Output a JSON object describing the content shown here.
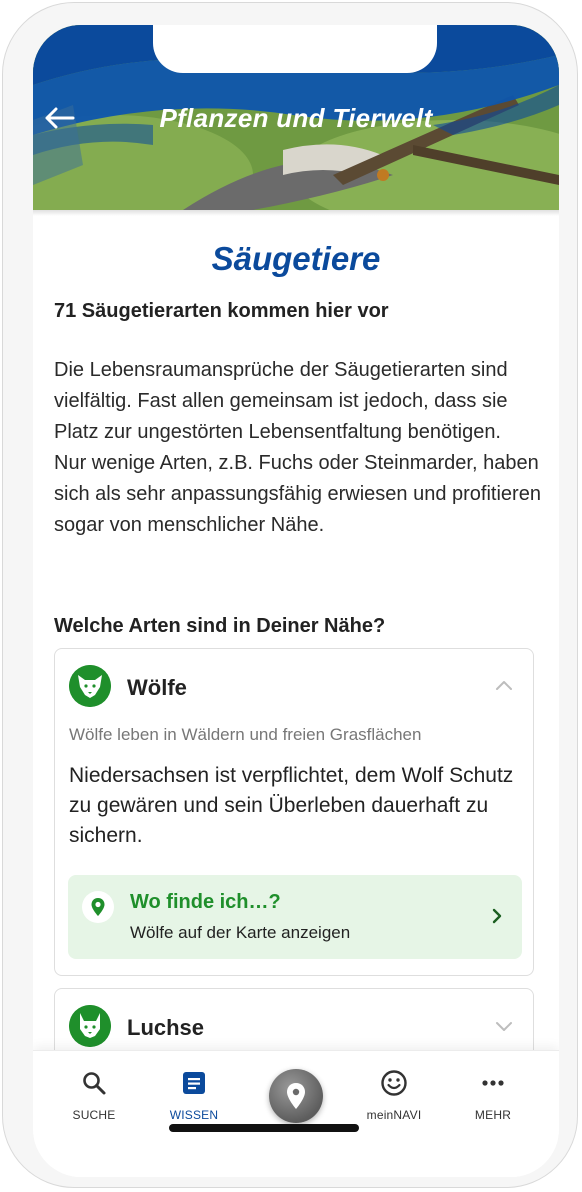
{
  "header": {
    "title": "Pflanzen und Tierwelt",
    "back_icon": "arrow-left-icon"
  },
  "main": {
    "page_title": "Säugetiere",
    "subtitle": "71 Säugetierarten kommen hier vor",
    "body": "Die Lebensraumansprüche der Säugetierarten sind vielfältig. Fast allen gemeinsam ist jedoch, dass sie Platz zur ungestörten Lebensentfaltung benötigen.\nNur wenige Arten, z.B. Fuchs oder Steinmarder, haben sich als sehr anpassungsfähig erwiesen und profitieren sogar von menschlicher Nähe.",
    "question": "Welche Arten sind in Deiner Nähe?",
    "cards": [
      {
        "name": "Wölfe",
        "icon": "wolf-icon",
        "expanded": true,
        "description": "Wölfe leben in Wäldern und freien Grasflächen",
        "body": "Niedersachsen ist verpflichtet, dem Wolf Schutz zu gewären und sein Überleben dauerhaft zu sichern.",
        "find_title": "Wo finde ich…?",
        "find_subtitle": "Wölfe auf der Karte anzeigen"
      },
      {
        "name": "Luchse",
        "icon": "lynx-icon",
        "expanded": false
      }
    ]
  },
  "bottom_nav": {
    "items": [
      {
        "label": "SUCHE",
        "icon": "search-icon",
        "active": false
      },
      {
        "label": "WISSEN",
        "icon": "article-icon",
        "active": true
      },
      {
        "label": "",
        "icon": "location-pin-icon",
        "active": false
      },
      {
        "label": "meinNAVI",
        "icon": "smiley-icon",
        "active": false
      },
      {
        "label": "MEHR",
        "icon": "more-dots-icon",
        "active": false
      }
    ]
  },
  "colors": {
    "brand_blue": "#0b4a9c",
    "accent_green": "#1f8f2b",
    "find_box_bg": "#e6f5e6"
  }
}
